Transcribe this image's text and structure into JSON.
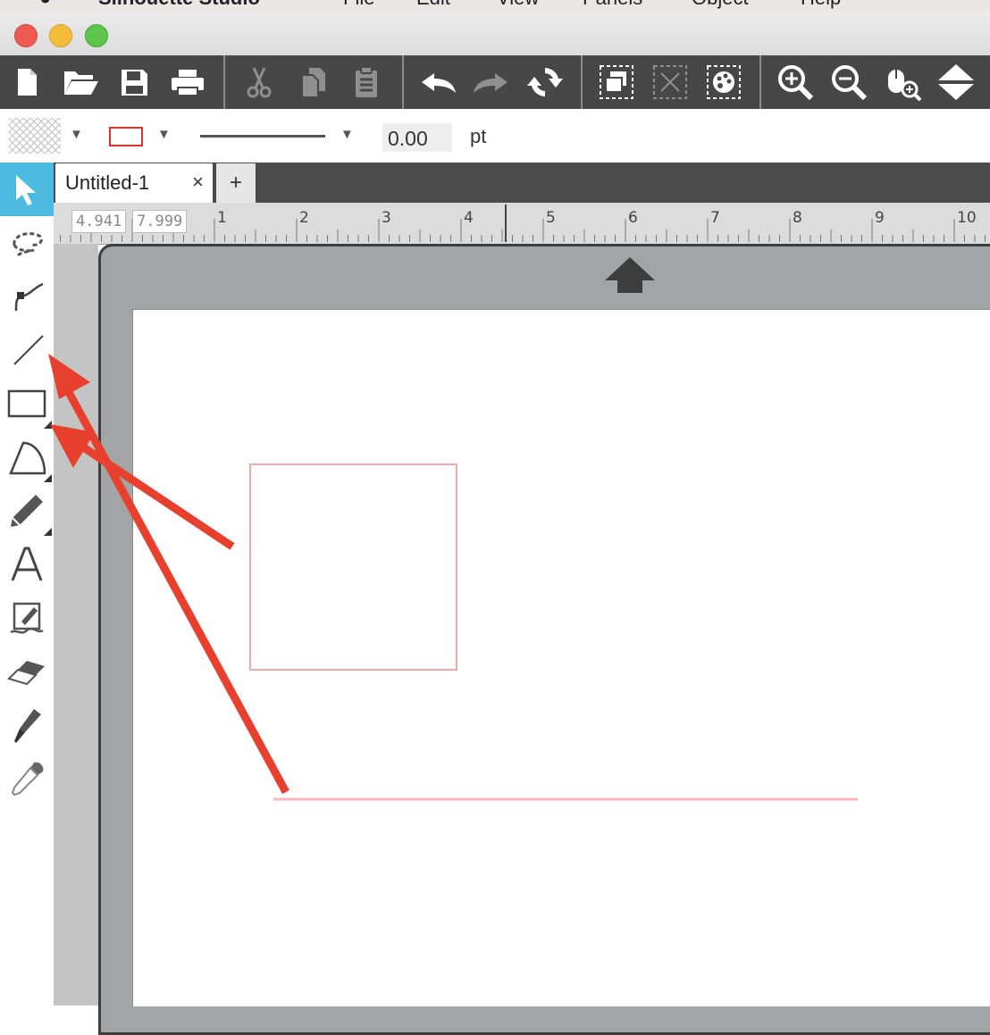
{
  "menubar": {
    "app_name": "Silhouette Studio",
    "items": [
      "File",
      "Edit",
      "View",
      "Panels",
      "Object",
      "Help"
    ]
  },
  "toolbar": {
    "buttons": [
      "new-document-icon",
      "open-folder-icon",
      "save-icon",
      "print-icon",
      "cut-icon",
      "copy-icon",
      "paste-icon",
      "undo-icon",
      "redo-icon",
      "refresh-icon",
      "group-icon",
      "ungroup-icon",
      "release-compound-icon",
      "zoom-in-icon",
      "zoom-out-icon",
      "zoom-select-icon",
      "fit-to-page-icon"
    ]
  },
  "properties": {
    "line_width_value": "0.00",
    "line_width_unit": "pt",
    "line_color": "#d9342b"
  },
  "tabs": {
    "active_label": "Untitled-1",
    "close_symbol": "×",
    "add_symbol": "+"
  },
  "ruler": {
    "coord_x": "4.941",
    "coord_y": "7.999",
    "ticks": [
      "1",
      "2",
      "3",
      "4",
      "5",
      "6",
      "7",
      "8",
      "9",
      "10"
    ]
  },
  "tools": [
    "select-tool-icon",
    "point-edit-icon",
    "curve-tool-icon",
    "line-tool-icon",
    "rectangle-tool-icon",
    "polygon-tool-icon",
    "pencil-tool-icon",
    "text-tool-icon",
    "sketch-tool-icon",
    "eraser-tool-icon",
    "knife-tool-icon",
    "eyedropper-tool-icon"
  ],
  "colors": {
    "accent": "#4dbbe0",
    "toolbar_bg": "#474747",
    "shape_stroke": "#f4a6ac",
    "annotation_arrow": "#e8402e"
  }
}
